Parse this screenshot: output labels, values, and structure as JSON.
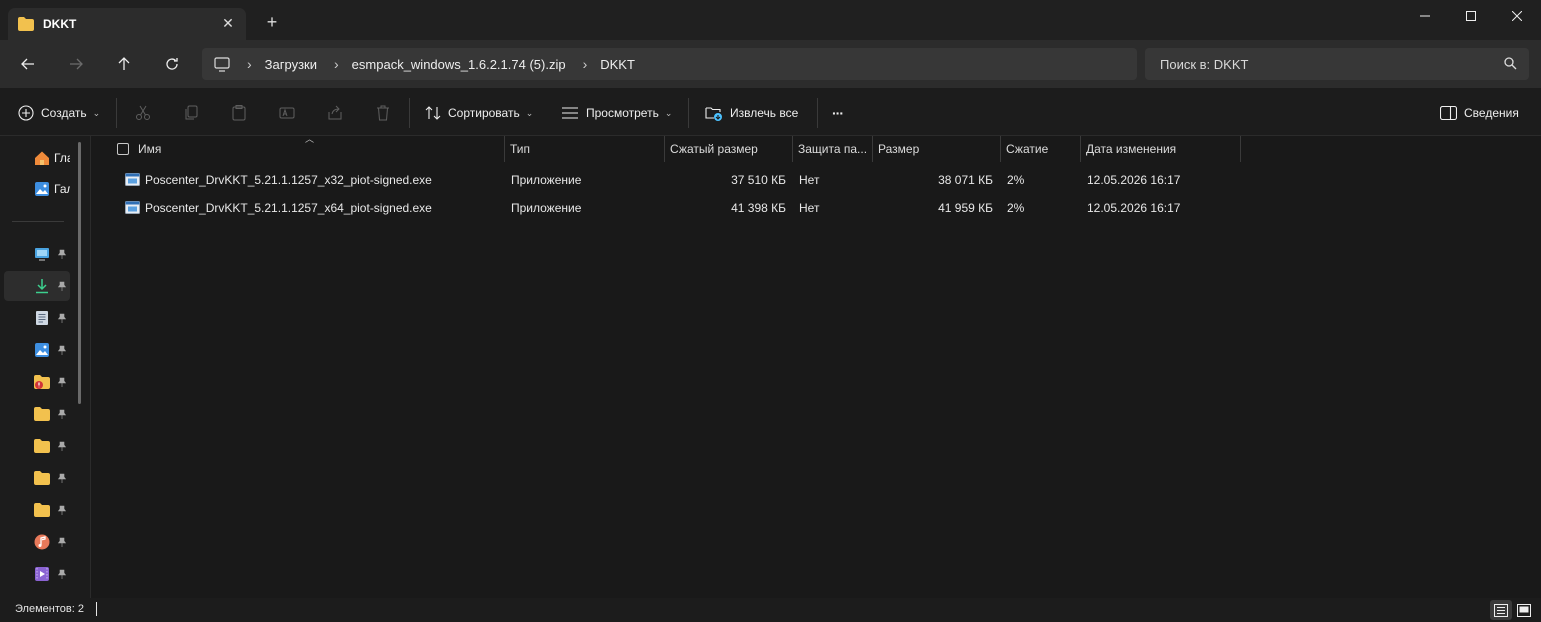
{
  "window": {
    "tab_title": "DKKT",
    "tab_close_glyph": "✕",
    "new_tab_glyph": "+"
  },
  "nav": {
    "crumbs": [
      "Загрузки",
      "esmpack_windows_1.6.2.1.74 (5).zip",
      "DKKT"
    ],
    "separator": "›",
    "search_placeholder": "Поиск в: DKKT"
  },
  "toolbar": {
    "create_label": "Создать",
    "sort_label": "Сортировать",
    "view_label": "Просмотреть",
    "extract_label": "Извлечь все",
    "more_label": "···",
    "details_label": "Сведения",
    "chevron": "⌄"
  },
  "sidebar": {
    "items": [
      {
        "label": "Главная",
        "icon": "home-icon"
      },
      {
        "label": "Галерея",
        "icon": "gallery-icon"
      }
    ],
    "pinned_icons": [
      "desktop-icon",
      "downloads-icon",
      "documents-icon",
      "pictures-icon",
      "folder-warning-icon",
      "folder-icon",
      "folder-icon",
      "folder-icon",
      "folder-icon",
      "music-icon",
      "videos-icon"
    ],
    "active_pinned_index": 1,
    "pin_glyph": "📌"
  },
  "table": {
    "columns": [
      "Имя",
      "Тип",
      "Сжатый размер",
      "Защита па...",
      "Размер",
      "Сжатие",
      "Дата изменения"
    ],
    "rows": [
      {
        "name": "Poscenter_DrvKKT_5.21.1.1257_x32_piot-signed.exe",
        "type": "Приложение",
        "compressed": "37 510 КБ",
        "protected": "Нет",
        "size": "38 071 КБ",
        "ratio": "2%",
        "modified": "12.05.2026 16:17"
      },
      {
        "name": "Poscenter_DrvKKT_5.21.1.1257_x64_piot-signed.exe",
        "type": "Приложение",
        "compressed": "41 398 КБ",
        "protected": "Нет",
        "size": "41 959 КБ",
        "ratio": "2%",
        "modified": "12.05.2026 16:17"
      }
    ]
  },
  "status": {
    "items_label": "Элементов: 2"
  },
  "colors": {
    "folder": "#f2c14e",
    "accent": "#4cc2ff",
    "download": "#3ccf8e"
  }
}
